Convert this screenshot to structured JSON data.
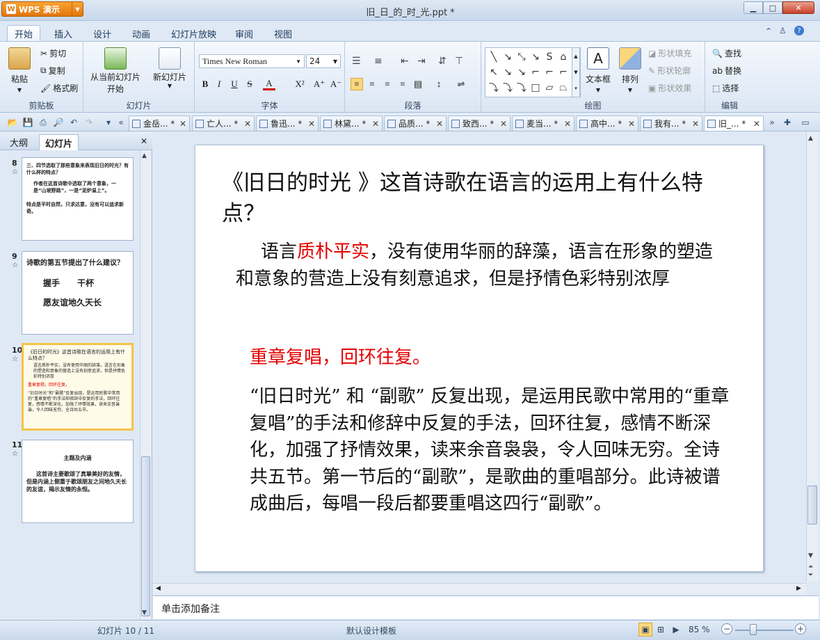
{
  "app": {
    "name": "WPS 演示",
    "doc_title": "旧_日_的_时_光.ppt *"
  },
  "window_buttons": {
    "min": "▭",
    "max": "□",
    "close": "✕"
  },
  "ribbon_tabs": [
    "开始",
    "插入",
    "设计",
    "动画",
    "幻灯片放映",
    "审阅",
    "视图"
  ],
  "ribbon_right": {
    "up": "⌃",
    "shirt": "👕",
    "help": "?"
  },
  "ribbon": {
    "clipboard": {
      "group": "剪贴板",
      "paste": "粘贴",
      "cut": "剪切",
      "copy": "复制",
      "format_painter": "格式刷"
    },
    "slides": {
      "group": "幻灯片",
      "from_current_1": "从当前幻灯片",
      "from_current_2": "开始",
      "new_slide": "新幻灯片"
    },
    "font": {
      "group": "字体",
      "name": "Times New Roman",
      "size": "24",
      "bold": "B",
      "italic": "I",
      "underline": "U",
      "strike": "S",
      "color": "A",
      "super": "X²",
      "grow": "A⁺",
      "shrink": "A⁻"
    },
    "paragraph": {
      "group": "段落"
    },
    "drawing": {
      "group": "绘图",
      "textbox": "文本框",
      "arrange": "排列",
      "shape_fill": "形状填充",
      "shape_outline": "形状轮廓",
      "shape_effect": "形状效果"
    },
    "editing": {
      "group": "编辑",
      "find": "查找",
      "replace": "替换",
      "select": "选择"
    }
  },
  "doc_tabs": [
    "金岳... *",
    "亡人... *",
    "鲁迅... *",
    "林黛... *",
    "品质... *",
    "致西... *",
    "麦当... *",
    "高中... *",
    "我有... *",
    "旧_... *"
  ],
  "left_panel": {
    "tabs": [
      "大纲",
      "幻灯片"
    ],
    "close": "✕",
    "slides": [
      {
        "num": "8",
        "lines": [
          "三、四节选取了那些意象来表现旧日的时光？有什么样的特点？",
          "作者在这首诗歌中选取了两个意象，一是“山坡野路”，一是“泥炉温上”。",
          "特点是平时自然，只求达意，没有可以追求新奇。"
        ]
      },
      {
        "num": "9",
        "lines": [
          "诗歌的第五节提出了什么建议？",
          "握手      干杯",
          "愿友谊地久天长"
        ]
      },
      {
        "num": "10",
        "lines": [
          "《旧日的时光》这首诗歌在语言的运用上有什么特点？",
          "语言质朴平实，没有使用华丽的辞藻，语言在形象的塑造和意象的营造上没有刻意追求，但是抒情色彩特别浓厚",
          "重章复唱，回环往复。",
          "“旧日时光”和“副歌”反复出现，是运用民歌中常用的“重章复唱”的手法和修辞中反复的手法，回环往复，感情不断深化，加强了抒情效果，读来余音袅袅，令人回味无穷。全诗共五节。"
        ]
      },
      {
        "num": "11",
        "lines": [
          "主题及内涵",
          "这首诗主要歌颂了真挚美好的友情，但是内涵上侧重于歌颂朋友之间地久天长的友谊，揭示友情的永恒。"
        ]
      }
    ]
  },
  "slide": {
    "title": "《旧日的时光 》这首诗歌在语言的运用上有什么特点？",
    "p1_a": "语言",
    "p1_red": "质朴平实",
    "p1_b": "，没有使用华丽的辞藻，语言在形象的塑造和意象的营造上没有刻意追求，但是抒情色彩特别浓厚",
    "red_heading": "重章复唱，回环往复。",
    "p2": "“旧日时光” 和 “副歌” 反复出现，是运用民歌中常用的“重章复唱”的手法和修辞中反复的手法，回环往复，感情不断深化，加强了抒情效果，读来余音袅袅，令人回味无穷。全诗共五节。第一节后的“副歌”，是歌曲的重唱部分。此诗被谱成曲后，每唱一段后都要重唱这四行“副歌”。"
  },
  "notes_placeholder": "单击添加备注",
  "status": {
    "slide_pos": "幻灯片 10 / 11",
    "template": "默认设计模板",
    "zoom": "85 %"
  },
  "colors": {
    "accent_red": "#e30000",
    "selection": "#f5c346",
    "app_orange": "#e2760c"
  }
}
